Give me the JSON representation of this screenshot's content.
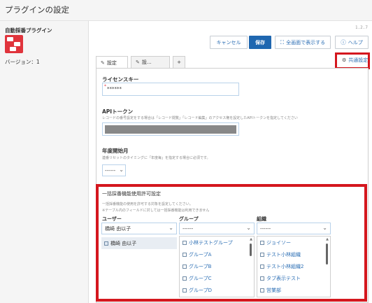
{
  "page": {
    "title": "プラグインの設定"
  },
  "plugin": {
    "name": "自動採番プラグイン",
    "version_label": "バージョン：1"
  },
  "version_number": "1.2.7",
  "buttons": {
    "cancel": "キャンセル",
    "save": "保存",
    "fullscreen": "全画面で表示する",
    "help": "ヘルプ"
  },
  "tabs": [
    {
      "label": "設定"
    },
    {
      "label": "設..."
    },
    {
      "label": "+"
    }
  ],
  "global_settings": "共通設定",
  "license": {
    "label": "ライセンスキー",
    "value": "******"
  },
  "api_token": {
    "label": "APIトークン",
    "description": "レコードの番号設定をする場合は「レコード閲覧」「レコード編集」のアクセス権を設定したAPIトークンを指定してください"
  },
  "fiscal_month": {
    "label": "年度開始月",
    "description": "連番リセットのタイミングに「年度毎」を指定する場合に必須です。",
    "value": "------"
  },
  "bulk": {
    "title": "一括採番機能使用許可設定",
    "description1": "一括採番機能の使用を許可する対象を設定してください。",
    "description2": "※テーブル内のフィールドに対しては一括採番機能は利用できません",
    "user": {
      "header": "ユーザー",
      "selected": "橋崎 由以子",
      "items": [
        "橋崎 由以子"
      ]
    },
    "group": {
      "header": "グループ",
      "selected": "------",
      "items": [
        "小林テストグループ",
        "グループA",
        "グループB",
        "グループC",
        "グループD"
      ]
    },
    "org": {
      "header": "組織",
      "selected": "------",
      "items": [
        "ジョイソー",
        "テスト小林組織",
        "テスト小林組織2",
        "タブ表示テスト",
        "営業部"
      ]
    }
  },
  "colors": {
    "accent": "#1f67b0",
    "highlight": "#d4171e",
    "plugin_icon": "#e0343c"
  }
}
